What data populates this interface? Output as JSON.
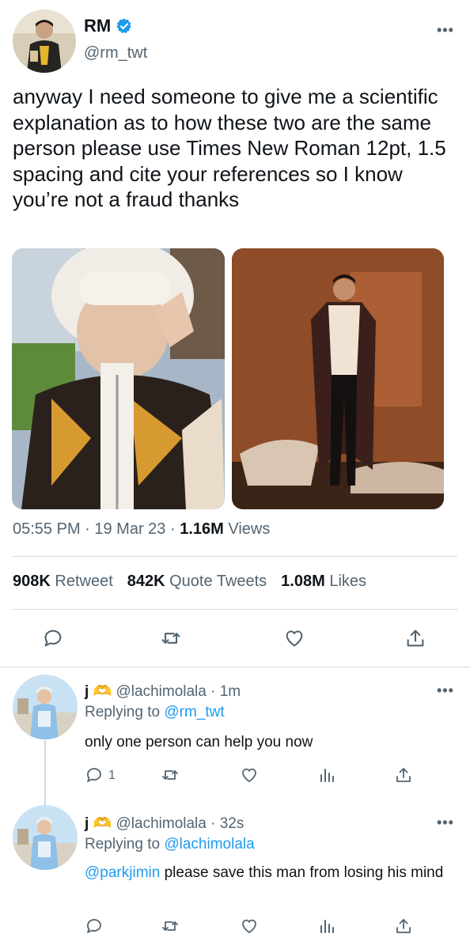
{
  "tweet": {
    "author_name": "RM",
    "author_handle": "@rm_twt",
    "more_label": "•••",
    "text": "anyway I need someone to give me a scientific explanation as to how these two are the same person please use Times New Roman 12pt, 1.5 spacing and cite your references so I know you’re not a fraud thanks",
    "time": "05:55 PM · 19 Mar 23 · ",
    "views_count": "1.16M",
    "views_label": "Views",
    "stats": {
      "retweets_count": "908K",
      "retweets_label": "Retweet",
      "quotes_count": "842K",
      "quotes_label": "Quote Tweets",
      "likes_count": "1.08M",
      "likes_label": "Likes"
    },
    "actions": [
      "reply-icon",
      "retweet-icon",
      "like-icon",
      "share-icon"
    ]
  },
  "replies": [
    {
      "name": "j",
      "name_emoji": "🫶",
      "handle_time": "@lachimolala · 1m",
      "replying_prefix": "Replying to",
      "replying_to": "@rm_twt",
      "mention": "",
      "text": "only one person can help you now",
      "reply_count": "1",
      "more_label": "•••"
    },
    {
      "name": "j",
      "name_emoji": "🫶",
      "handle_time": "@lachimolala · 32s",
      "replying_prefix": "Replying to",
      "replying_to": "@lachimolala",
      "mention": "@parkjimin",
      "text": "please save this man from losing his mind",
      "reply_count": "",
      "more_label": "•••"
    }
  ],
  "colors": {
    "accent": "#1d9bf0",
    "muted": "#536471",
    "divider": "#cfd9de"
  }
}
